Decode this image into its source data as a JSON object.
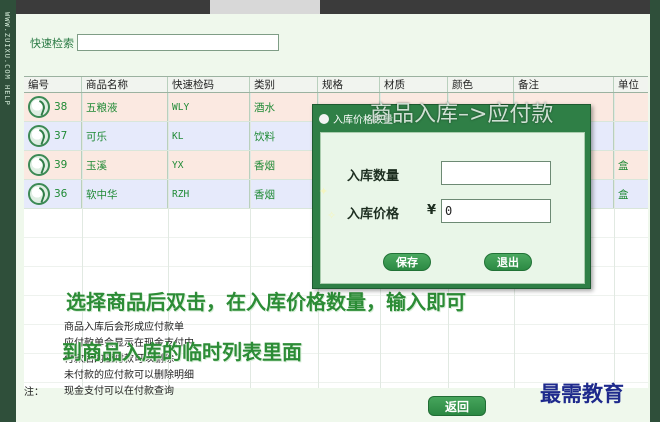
{
  "search": {
    "label": "快速检索",
    "value": ""
  },
  "grid": {
    "columns": [
      "编号",
      "商品名称",
      "快速检码",
      "类别",
      "规格",
      "材质",
      "颜色",
      "备注",
      "单位"
    ],
    "rows": [
      {
        "id": "38",
        "name": "五粮液",
        "code": "WLY",
        "category": "酒水",
        "unit": ""
      },
      {
        "id": "37",
        "name": "可乐",
        "code": "KL",
        "category": "饮料",
        "unit": ""
      },
      {
        "id": "39",
        "name": "玉溪",
        "code": "YX",
        "category": "香烟",
        "unit": "盒"
      },
      {
        "id": "36",
        "name": "软中华",
        "code": "RZH",
        "category": "香烟",
        "unit": "盒"
      }
    ]
  },
  "overlay_heading": "商品入库–>应付款",
  "dialog": {
    "title": "入库价格数量",
    "qty_label": "入库数量",
    "qty_value": "",
    "price_label": "入库价格",
    "currency": "¥",
    "price_value": "0",
    "save_label": "保存",
    "exit_label": "退出"
  },
  "caption": {
    "line1": "选择商品后双击，在入库价格数量，输入即可",
    "line2": "到商品入库的临时列表里面"
  },
  "notes": {
    "prefix": "注：",
    "lines": [
      "商品入库后会形成应付款单",
      "应付款单会显示在现金支付中",
      "付款后的应付款可以删除",
      "未付款的应付款可以删除明细",
      "现金支付可以在付款查询"
    ]
  },
  "return_label": "返回",
  "watermark": "最需教育",
  "rail_text": "WWW.ZUIXU.COM  HELP"
}
